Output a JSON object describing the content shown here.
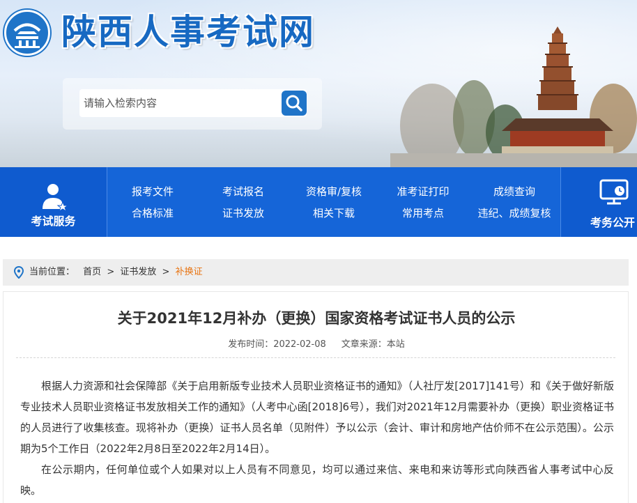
{
  "site": {
    "name": "陕西人事考试网"
  },
  "search": {
    "placeholder": "请输入检索内容"
  },
  "nav": {
    "service_label": "考试服务",
    "public_label": "考务公开",
    "links_row1": [
      "报考文件",
      "考试报名",
      "资格审/复核",
      "准考证打印",
      "成绩查询"
    ],
    "links_row2": [
      "合格标准",
      "证书发放",
      "相关下载",
      "常用考点",
      "违纪、成绩复核"
    ]
  },
  "breadcrumb": {
    "prefix": "当前位置：",
    "items": [
      "首页",
      "证书发放",
      "补换证"
    ],
    "separator": ">"
  },
  "article": {
    "title": "关于2021年12月补办（更换）国家资格考试证书人员的公示",
    "publish_label": "发布时间：",
    "publish_date": "2022-02-08",
    "source_label": "文章来源：",
    "source": "本站",
    "paragraphs": [
      "根据人力资源和社会保障部《关于启用新版专业技术人员职业资格证书的通知》（人社厅发[2017]141号）和《关于做好新版专业技术人员职业资格证书发放相关工作的通知》（人考中心函[2018]6号），我们对2021年12月需要补办（更换）职业资格证书的人员进行了收集核查。现将补办（更换）证书人员名单（见附件）予以公示（会计、审计和房地产估价师不在公示范围）。公示期为5个工作日（2022年2月8日至2022年2月14日）。",
      "在公示期内，任何单位或个人如果对以上人员有不同意见，均可以通过来信、来电和来访等形式向陕西省人事考试中心反映。"
    ]
  },
  "colors": {
    "brand_blue": "#1565d8",
    "accent_orange": "#e87412",
    "breadcrumb_bg": "#eeeeee"
  }
}
